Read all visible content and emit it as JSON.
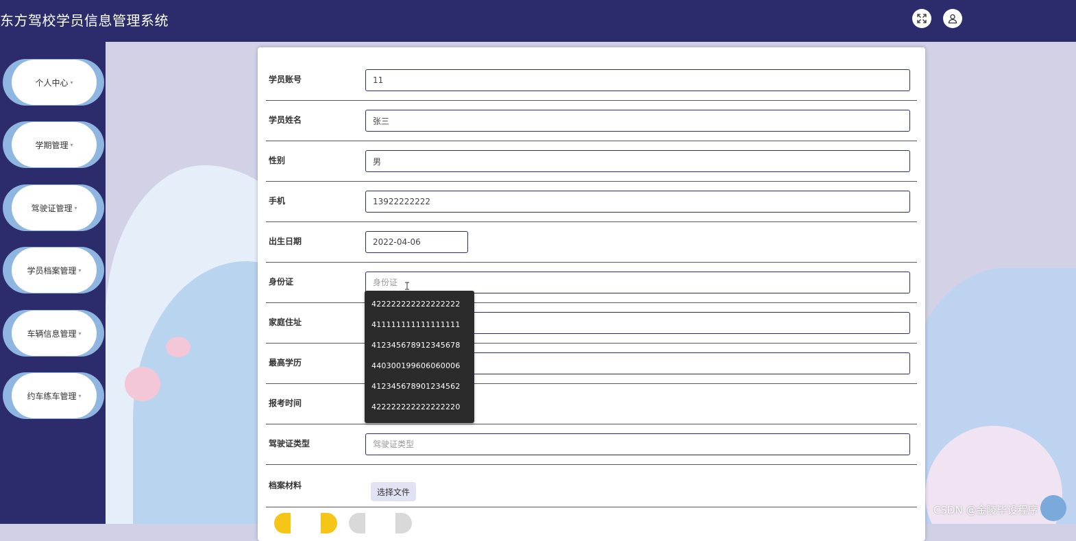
{
  "header": {
    "title": "东方驾校学员信息管理系统",
    "icons": [
      "fullscreen-icon",
      "user-icon"
    ]
  },
  "sidebar": {
    "items": [
      {
        "label": "个人中心"
      },
      {
        "label": "学期管理"
      },
      {
        "label": "驾驶证管理"
      },
      {
        "label": "学员档案管理"
      },
      {
        "label": "车辆信息管理"
      },
      {
        "label": "约车练车管理"
      }
    ],
    "caret": "▾"
  },
  "form": {
    "fields": [
      {
        "label": "学员账号",
        "value": "11",
        "placeholder": "学员账号"
      },
      {
        "label": "学员姓名",
        "value": "张三",
        "placeholder": "学员姓名"
      },
      {
        "label": "性别",
        "value": "男",
        "placeholder": "性别"
      },
      {
        "label": "手机",
        "value": "13922222222",
        "placeholder": "手机"
      },
      {
        "label": "出生日期",
        "value": "2022-04-06",
        "placeholder": "出生日期"
      },
      {
        "label": "身份证",
        "value": "",
        "placeholder": "身份证"
      },
      {
        "label": "家庭住址",
        "value": "",
        "placeholder": ""
      },
      {
        "label": "最高学历",
        "value": "",
        "placeholder": ""
      },
      {
        "label": "报考时间",
        "value": "",
        "placeholder": ""
      },
      {
        "label": "驾驶证类型",
        "value": "",
        "placeholder": "驾驶证类型"
      },
      {
        "label": "档案材料"
      }
    ],
    "file_button": "选择文件"
  },
  "autocomplete": {
    "options": [
      "422222222222222222",
      "411111111111111111",
      "412345678912345678",
      "440300199606060006",
      "412345678901234562",
      "422222222222222220"
    ]
  },
  "watermark": "CSDN @金陵毕设程序",
  "colors": {
    "primary": "#2c2c6c",
    "sidebar_ring": "#8fb6e0",
    "submit": "#f5c518",
    "reset": "#d9d9d9"
  }
}
